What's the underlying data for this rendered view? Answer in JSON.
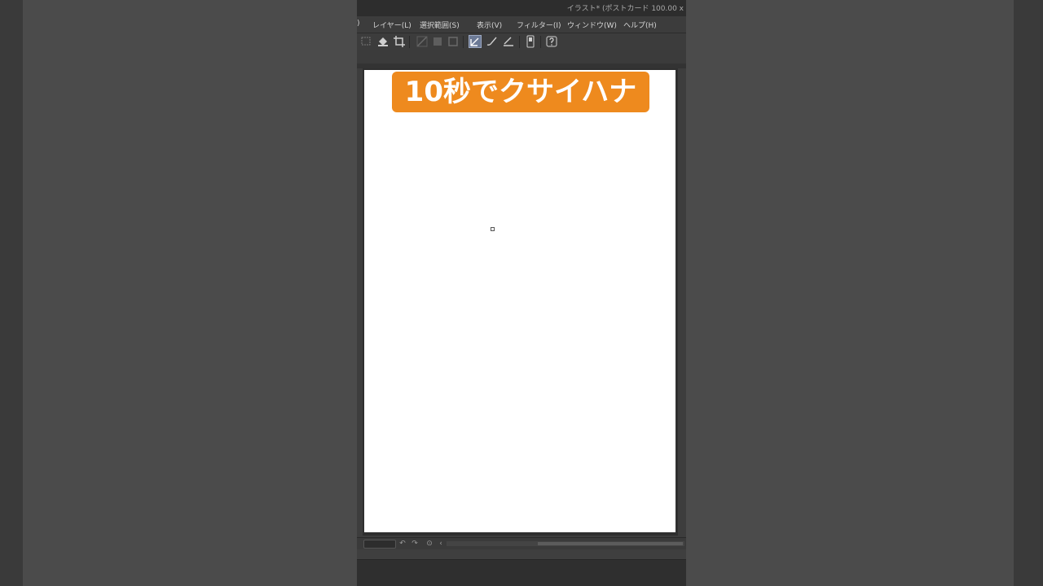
{
  "window": {
    "title": "イラスト* (ポストカード 100.00 x"
  },
  "menu": {
    "items": [
      {
        "label": ")"
      },
      {
        "label": "レイヤー(L)"
      },
      {
        "label": "選択範囲(S)"
      },
      {
        "label": "表示(V)"
      },
      {
        "label": "フィルター(I)"
      },
      {
        "label": "ウィンドウ(W)"
      },
      {
        "label": "ヘルプ(H)"
      }
    ]
  },
  "toolbar": {
    "tools": [
      "selection-icon",
      "fill-icon",
      "crop-icon",
      "transform-icon",
      "rotate-icon",
      "layer-icon",
      "pen-icon",
      "brush-icon",
      "eraser-icon",
      "smartphone-icon",
      "help-icon"
    ],
    "active_tool": "pen-icon"
  },
  "canvas": {
    "banner_text": "10秒でクサイハナ",
    "banner_color": "#ee8a1e"
  },
  "statusbar": {
    "buttons": [
      "undo-icon",
      "redo-icon",
      "rotate-reset-icon",
      "chevron-left-icon"
    ]
  }
}
